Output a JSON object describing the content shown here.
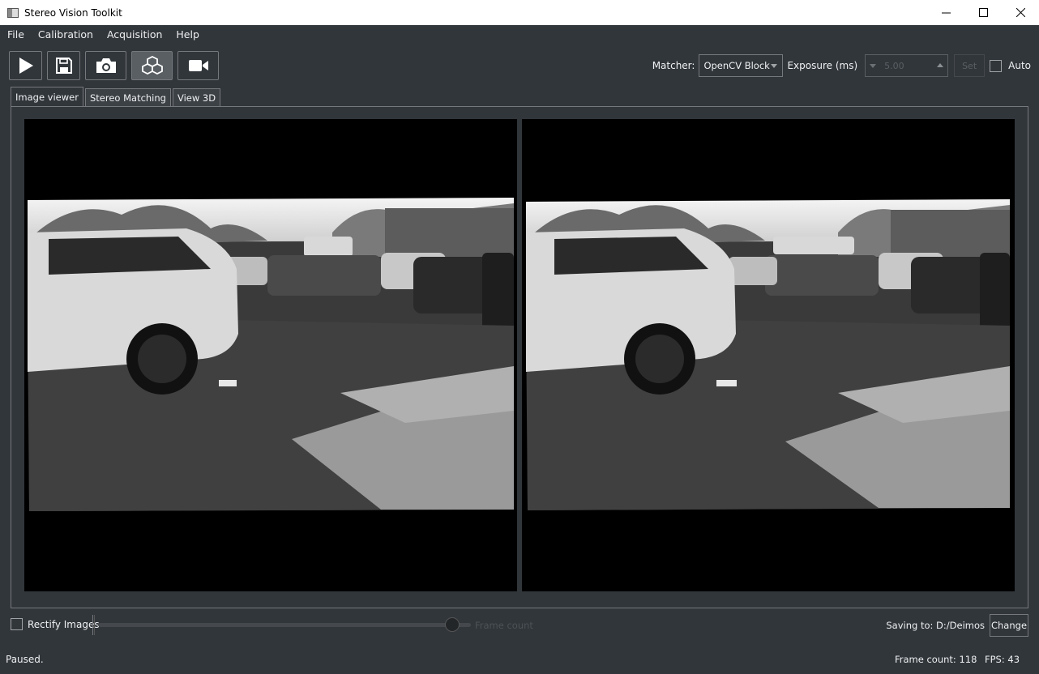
{
  "window": {
    "title": "Stereo Vision Toolkit"
  },
  "menu": [
    "File",
    "Calibration",
    "Acquisition",
    "Help"
  ],
  "toolbar": {
    "buttons": [
      {
        "icon": "play-icon"
      },
      {
        "icon": "save-icon"
      },
      {
        "icon": "camera-icon"
      },
      {
        "icon": "cubes-icon"
      },
      {
        "icon": "video-camera-icon"
      }
    ]
  },
  "matcher": {
    "label": "Matcher:",
    "value": "OpenCV Block"
  },
  "exposure": {
    "label": "Exposure (ms)",
    "value": "5.00",
    "set_label": "Set",
    "auto_label": "Auto",
    "auto_checked": false
  },
  "tabs": [
    "Image viewer",
    "Stereo Matching",
    "View 3D"
  ],
  "active_tab": 0,
  "bottom": {
    "rectify_label": "Rectify Images",
    "rectify_checked": false,
    "frame_slider_label": "Frame count",
    "frame_slider_position": 0.95,
    "saving_label": "Saving to:",
    "saving_path": "D:/Deimos",
    "change_label": "Change"
  },
  "status": {
    "message": "Paused.",
    "frame_count": "Frame count: 118",
    "fps": "FPS: 43"
  },
  "colors": {
    "background": "#31363b",
    "border": "#76797c",
    "text": "#eff0f1"
  }
}
